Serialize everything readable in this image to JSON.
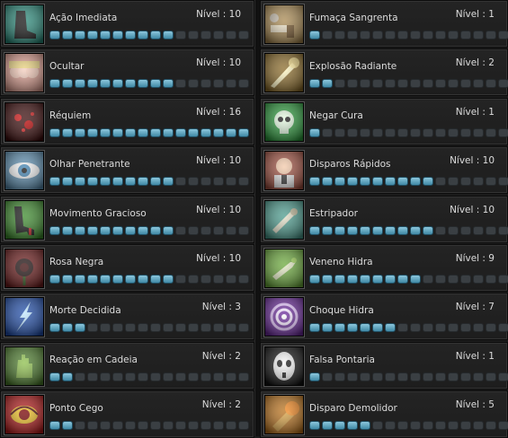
{
  "level_label": "Nível : ",
  "max_level": 16,
  "left_skills": [
    {
      "name": "Ação Imediata",
      "level": 10,
      "icon": "black-boot-icon"
    },
    {
      "name": "Ocultar",
      "level": 10,
      "icon": "clone-faces-icon"
    },
    {
      "name": "Réquiem",
      "level": 16,
      "icon": "red-splatter-icon"
    },
    {
      "name": "Olhar Penetrante",
      "level": 10,
      "icon": "eye-icon"
    },
    {
      "name": "Movimento Gracioso",
      "level": 10,
      "icon": "high-heel-icon"
    },
    {
      "name": "Rosa Negra",
      "level": 10,
      "icon": "black-rose-icon"
    },
    {
      "name": "Morte Decidida",
      "level": 3,
      "icon": "blue-lightning-icon"
    },
    {
      "name": "Reação em Cadeia",
      "level": 2,
      "icon": "green-hand-icon"
    },
    {
      "name": "Ponto Cego",
      "level": 2,
      "icon": "red-eye-icon"
    }
  ],
  "right_skills": [
    {
      "name": "Fumaça Sangrenta",
      "level": 1,
      "icon": "smoking-gun-icon"
    },
    {
      "name": "Explosão Radiante",
      "level": 2,
      "icon": "radiant-bullet-icon"
    },
    {
      "name": "Negar Cura",
      "level": 1,
      "icon": "green-skull-icon"
    },
    {
      "name": "Disparos Rápidos",
      "level": 10,
      "icon": "gunman-icon"
    },
    {
      "name": "Estripador",
      "level": 10,
      "icon": "blunderbuss-icon"
    },
    {
      "name": "Veneno Hidra",
      "level": 9,
      "icon": "poison-gun-icon"
    },
    {
      "name": "Choque Hidra",
      "level": 7,
      "icon": "purple-spiral-icon"
    },
    {
      "name": "Falsa Pontaria",
      "level": 1,
      "icon": "white-mask-icon"
    },
    {
      "name": "Disparo Demolidor",
      "level": 5,
      "icon": "fire-bullet-icon"
    }
  ],
  "icon_colors": {
    "black-boot-icon": "#2a8a7a",
    "clone-faces-icon": "#d99a8c",
    "red-splatter-icon": "#3a0a0a",
    "eye-icon": "#5a8cae",
    "high-heel-icon": "#3c8a2c",
    "black-rose-icon": "#6b1a1a",
    "blue-lightning-icon": "#1f4ca8",
    "green-hand-icon": "#4a7a2a",
    "red-eye-icon": "#b01818",
    "smoking-gun-icon": "#a88850",
    "radiant-bullet-icon": "#8a6a28",
    "green-skull-icon": "#2c9a3c",
    "gunman-icon": "#a05040",
    "blunderbuss-icon": "#4a9a8c",
    "poison-gun-icon": "#6aa83a",
    "purple-spiral-icon": "#6a2a9a",
    "white-mask-icon": "#dcdcdc",
    "fire-bullet-icon": "#b8701a"
  }
}
